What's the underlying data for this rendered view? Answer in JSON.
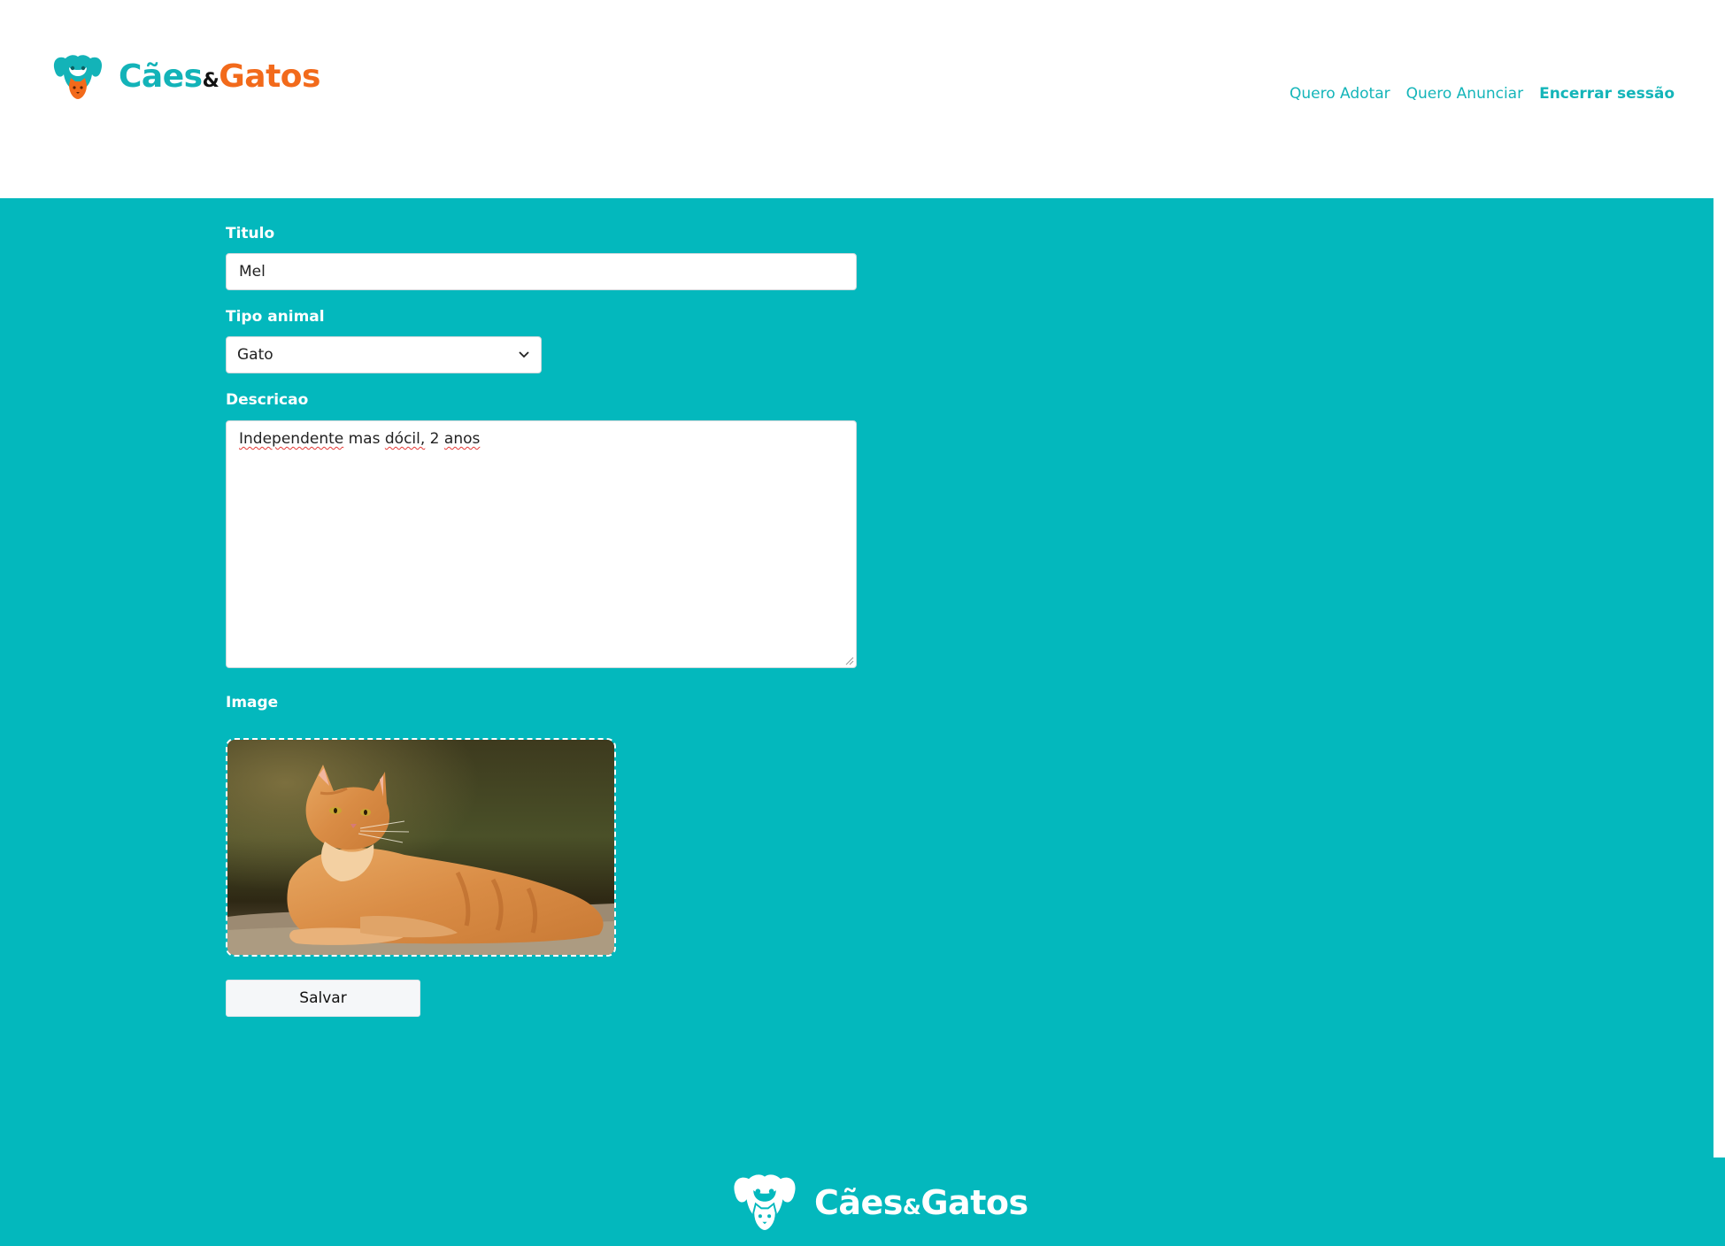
{
  "brand": {
    "name_part1": "Cães",
    "ampersand": "&",
    "name_part2": "Gatos"
  },
  "nav": {
    "items": [
      {
        "label": "Quero Adotar"
      },
      {
        "label": "Quero Anunciar"
      },
      {
        "label": "Encerrar sessão"
      }
    ]
  },
  "form": {
    "title_label": "Titulo",
    "title_value": "Mel",
    "type_label": "Tipo animal",
    "type_selected": "Gato",
    "description_label": "Descricao",
    "description_words": [
      "Independente",
      "mas",
      "dócil,",
      "2",
      "anos"
    ],
    "image_label": "Image",
    "image_alt": "Gato laranja deitado",
    "save_label": "Salvar"
  },
  "footer": {
    "name_part1": "Cães",
    "ampersand": "&",
    "name_part2": "Gatos"
  },
  "colors": {
    "teal": "#03b8bd",
    "brand_teal": "#13b3b8",
    "brand_orange": "#f26a1b"
  },
  "icons": {
    "logo": "dog-cat-heart-icon",
    "select_caret": "chevron-down-icon"
  }
}
